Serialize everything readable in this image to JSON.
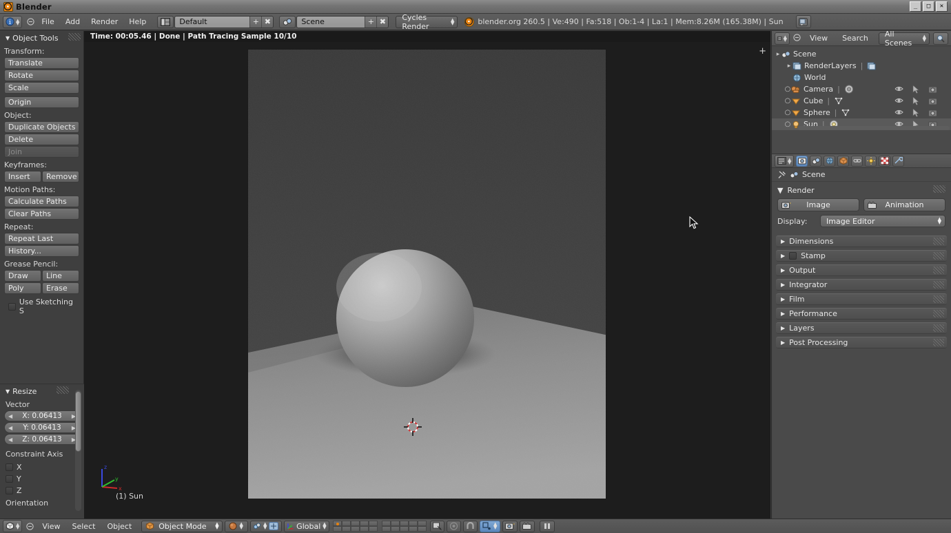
{
  "window": {
    "title": "Blender",
    "app_icon": "blender-logo-icon",
    "minimize": "_",
    "maximize": "□",
    "close": "✕"
  },
  "topbar": {
    "editor_type_icon": "info-editor-icon",
    "collapse_icon": "collapse-menus-icon",
    "menus": [
      "File",
      "Add",
      "Render",
      "Help"
    ],
    "screen_layout": {
      "icon": "screen-layout-icon",
      "value": "Default",
      "add": "+",
      "delete": "✖"
    },
    "scene": {
      "icon": "scene-data-icon",
      "value": "Scene",
      "add": "+",
      "delete": "✖"
    },
    "render_engine": {
      "value": "Cycles Render"
    },
    "stats": "blender.org 260.5 | Ve:490 | Fa:518 | Ob:1-4 | La:1 | Mem:8.26M (165.38M) | Sun",
    "report_icon": "report-window-icon"
  },
  "toolshelf": {
    "panel_title": "Object Tools",
    "sections": [
      {
        "label": "Transform:",
        "buttons": [
          "Translate",
          "Rotate",
          "Scale"
        ]
      },
      {
        "label": "",
        "buttons": [
          "Origin"
        ]
      },
      {
        "label": "Object:",
        "buttons": [
          "Duplicate Objects",
          "Delete"
        ],
        "disabled": [
          "Join"
        ]
      },
      {
        "label": "Keyframes:",
        "pairs": [
          [
            "Insert",
            "Remove"
          ]
        ]
      },
      {
        "label": "Motion Paths:",
        "buttons": [
          "Calculate Paths",
          "Clear Paths"
        ]
      },
      {
        "label": "Repeat:",
        "buttons": [
          "Repeat Last",
          "History..."
        ]
      },
      {
        "label": "Grease Pencil:",
        "pairs": [
          [
            "Draw",
            "Line"
          ],
          [
            "Poly",
            "Erase"
          ]
        ]
      }
    ],
    "checkbox": {
      "label": "Use Sketching S",
      "checked": false
    }
  },
  "operator_panel": {
    "title": "Resize",
    "vector_label": "Vector",
    "fields": [
      {
        "label": "X: 0.06413"
      },
      {
        "label": "Y: 0.06413"
      },
      {
        "label": "Z: 0.06413"
      }
    ],
    "constraint_label": "Constraint Axis",
    "axes": [
      {
        "label": "X",
        "checked": false
      },
      {
        "label": "Y",
        "checked": false
      },
      {
        "label": "Z",
        "checked": false
      }
    ],
    "orientation_label": "Orientation"
  },
  "viewport": {
    "render_info": "Time: 00:05.46 | Done | Path Tracing Sample 10/10",
    "active_object_label": "(1) Sun",
    "axis_labels": {
      "x": "x",
      "y": "y",
      "z": "z"
    },
    "axis_colors": {
      "x": "#cc2b2b",
      "y": "#2fbf2f",
      "z": "#3a49e0"
    },
    "add_region_icon": "plus-icon"
  },
  "outliner": {
    "header": {
      "editor_type_icon": "outliner-editor-icon",
      "collapse_icon": "collapse-menus-icon",
      "menus": [
        "View",
        "Search"
      ],
      "display_mode": "All Scenes",
      "filter_icon": "search-icon"
    },
    "rows": [
      {
        "name": "Scene",
        "icon": "scene-icon",
        "indent": 0,
        "expander": "-",
        "selected": false,
        "datablocks": []
      },
      {
        "name": "RenderLayers",
        "icon": "renderlayers-icon",
        "indent": 1,
        "expander": "+",
        "selected": false,
        "datablocks": [
          "renderlayer-data-icon"
        ]
      },
      {
        "name": "World",
        "icon": "world-icon",
        "indent": 1,
        "expander": "",
        "selected": false,
        "datablocks": []
      },
      {
        "name": "Camera",
        "icon": "camera-object-icon",
        "indent": 1,
        "expander": "o",
        "selected": false,
        "datablocks": [
          "camera-data-icon"
        ],
        "toggles": [
          "eye-icon",
          "cursor-arrow-icon",
          "render-camera-icon"
        ]
      },
      {
        "name": "Cube",
        "icon": "mesh-object-icon",
        "indent": 1,
        "expander": "o",
        "selected": false,
        "datablocks": [
          "mesh-data-icon"
        ],
        "toggles": [
          "eye-icon",
          "cursor-arrow-icon",
          "render-camera-icon"
        ]
      },
      {
        "name": "Sphere",
        "icon": "mesh-object-icon",
        "indent": 1,
        "expander": "o",
        "selected": false,
        "datablocks": [
          "mesh-data-icon"
        ],
        "toggles": [
          "eye-icon",
          "cursor-arrow-icon",
          "render-camera-icon"
        ]
      },
      {
        "name": "Sun",
        "icon": "lamp-object-icon",
        "indent": 1,
        "expander": "o",
        "selected": true,
        "datablocks": [
          "lamp-data-icon"
        ],
        "toggles": [
          "eye-icon",
          "cursor-arrow-icon",
          "render-camera-icon"
        ]
      }
    ]
  },
  "properties": {
    "editor_type_icon": "properties-editor-icon",
    "tabs": [
      {
        "name": "render-tab",
        "icon": "camera-back-icon",
        "active": true
      },
      {
        "name": "scene-tab",
        "icon": "scene-icon",
        "active": false
      },
      {
        "name": "world-tab",
        "icon": "world-icon",
        "active": false
      },
      {
        "name": "object-tab",
        "icon": "cube-icon",
        "active": false
      },
      {
        "name": "constraints-tab",
        "icon": "chain-link-icon",
        "active": false
      },
      {
        "name": "data-tab",
        "icon": "lamp-sun-icon",
        "active": false
      },
      {
        "name": "texture-tab",
        "icon": "checker-texture-icon",
        "active": false
      },
      {
        "name": "modifier-tab",
        "icon": "wrench-icon",
        "active": false
      }
    ],
    "breadcrumb": {
      "pin_icon": "pin-icon",
      "scene_icon": "scene-icon",
      "label": "Scene"
    },
    "render_panel": {
      "title": "Render",
      "image_button": {
        "label": "Image",
        "icon": "render-image-icon"
      },
      "animation_button": {
        "label": "Animation",
        "icon": "render-animation-icon"
      },
      "display_label": "Display:",
      "display_value": "Image Editor"
    },
    "closed_panels": [
      {
        "label": "Dimensions",
        "checkbox": false
      },
      {
        "label": "Stamp",
        "checkbox": true
      },
      {
        "label": "Output",
        "checkbox": false
      },
      {
        "label": "Integrator",
        "checkbox": false
      },
      {
        "label": "Film",
        "checkbox": false
      },
      {
        "label": "Performance",
        "checkbox": false
      },
      {
        "label": "Layers",
        "checkbox": false
      },
      {
        "label": "Post Processing",
        "checkbox": false
      }
    ]
  },
  "bottombar": {
    "editor_type_icon": "view3d-editor-icon",
    "collapse_icon": "collapse-menus-icon",
    "menus": [
      "View",
      "Select",
      "Object"
    ],
    "mode": {
      "icon": "object-mode-icon",
      "value": "Object Mode"
    },
    "shading": {
      "icon": "solid-shading-icon"
    },
    "pivot": {
      "icon": "pivot-median-icon"
    },
    "snap_magnet": {
      "icon": "magnet-icon",
      "enabled": false
    },
    "manipulator": {
      "icon": "manipulator-icon",
      "enabled": true
    },
    "transform_orientation": {
      "icon": "orientation-icon",
      "value": "Global"
    },
    "layers": {
      "rows": 2,
      "cols": 5,
      "groups": 2,
      "used_layer": 0
    },
    "extra_buttons": [
      {
        "icon": "render-border-icon"
      },
      {
        "icon": "proportional-edit-icon"
      },
      {
        "icon": "magnet-snap-icon"
      },
      {
        "icon": "snap-element-icon"
      },
      {
        "icon": "render-image-icon"
      },
      {
        "icon": "render-animation-icon"
      },
      {
        "icon": "pause-icon"
      }
    ]
  }
}
